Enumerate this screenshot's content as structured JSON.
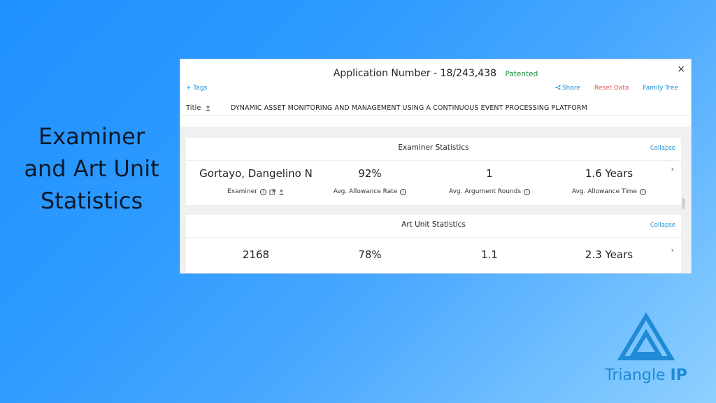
{
  "slide": {
    "heading_lines": [
      "Examiner",
      "and Art Unit",
      "Statistics"
    ]
  },
  "panel": {
    "app_number": "Application Number - 18/243,438",
    "status": "Patented",
    "close_label": "×",
    "tags_label": "+ Tags",
    "share_label": "Share",
    "reset_label": "Reset Data",
    "family_tree_label": "Family Tree",
    "title_label": "Title",
    "title_value": "DYNAMIC ASSET MONITORING AND MANAGEMENT USING A CONTINUOUS EVENT PROCESSING PLATFORM"
  },
  "examiner_stats": {
    "title": "Examiner Statistics",
    "collapse_label": "Collapse",
    "items": [
      {
        "value": "Gortayo, Dangelino N",
        "label": "Examiner"
      },
      {
        "value": "92%",
        "label": "Avg. Allowance Rate"
      },
      {
        "value": "1",
        "label": "Avg. Argument Rounds"
      },
      {
        "value": "1.6 Years",
        "label": "Avg. Allowance Time"
      }
    ]
  },
  "art_unit_stats": {
    "title": "Art Unit Statistics",
    "collapse_label": "Collapse",
    "items": [
      {
        "value": "2168"
      },
      {
        "value": "78%"
      },
      {
        "value": "1.1"
      },
      {
        "value": "2.3 Years"
      }
    ]
  },
  "logo": {
    "name": "Triangle",
    "suffix": "IP",
    "color": "#1f8ad6"
  },
  "colors": {
    "accent": "#1a8cd8",
    "status_green": "#1e8e3e",
    "reset_red": "#e05a4e"
  }
}
